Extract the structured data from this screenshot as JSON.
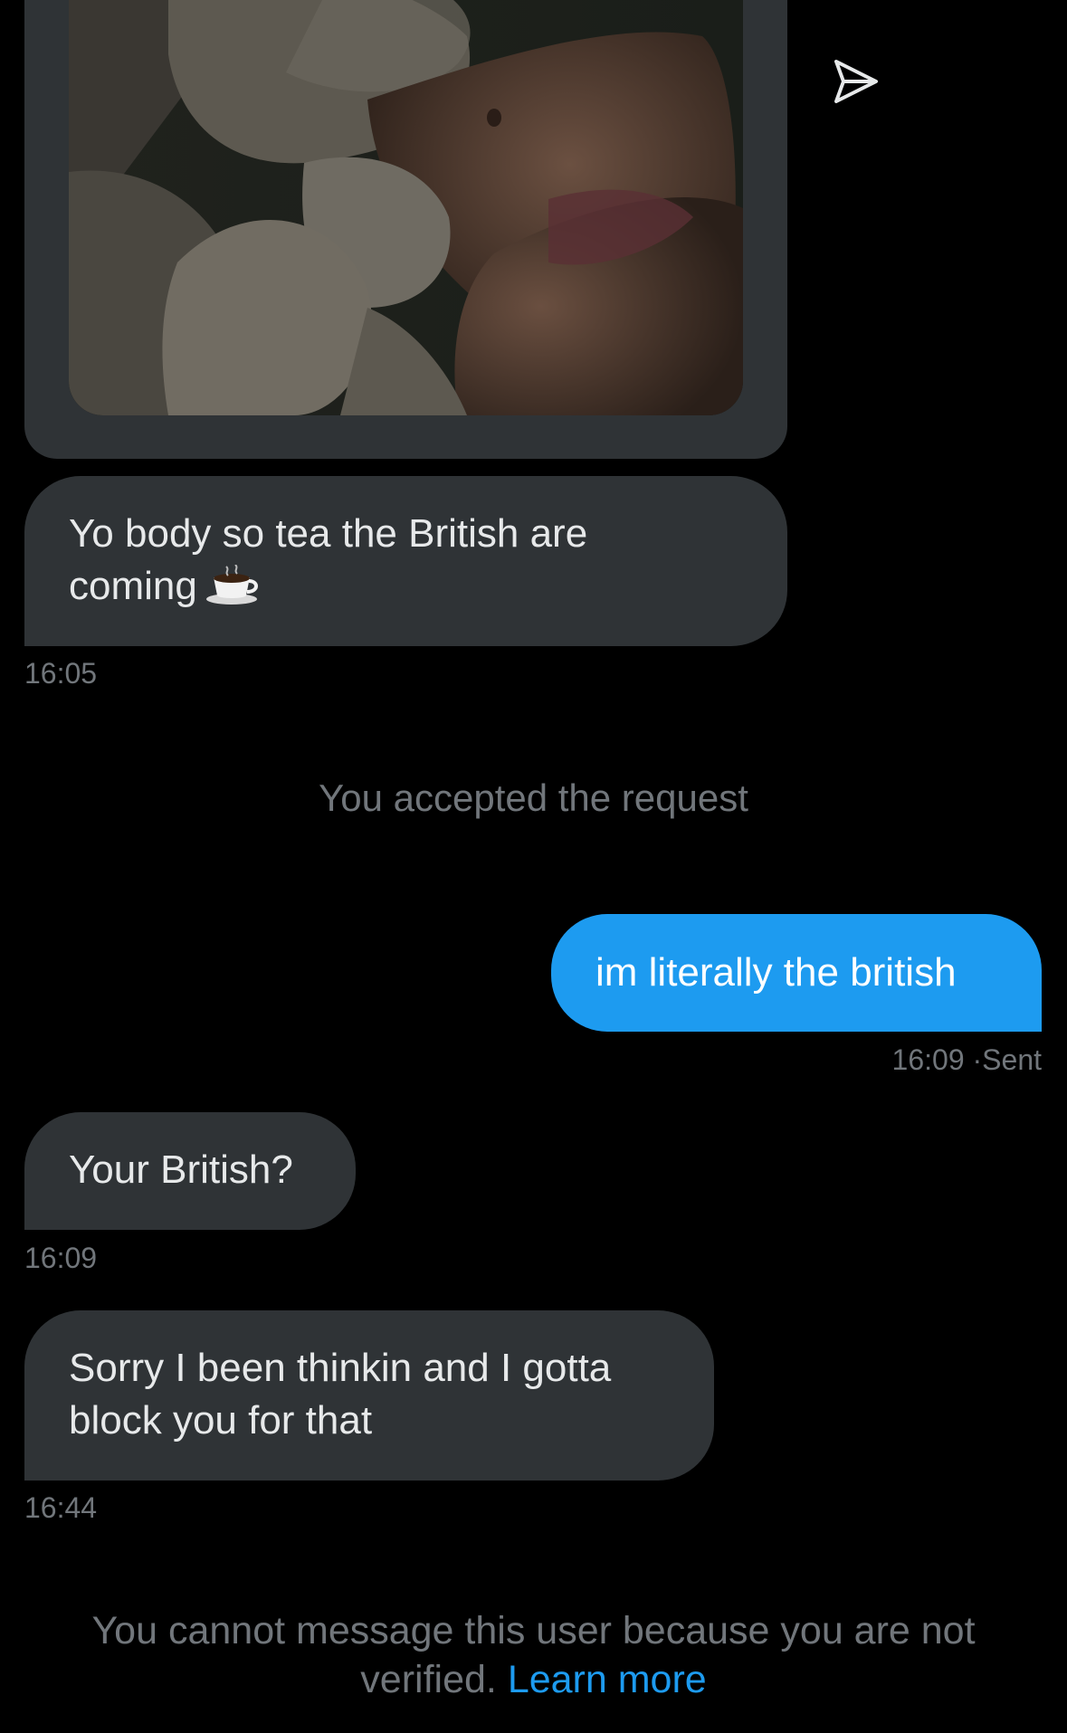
{
  "colors": {
    "background": "#000000",
    "incoming_bubble": "#2f3336",
    "outgoing_bubble": "#1d9bf0",
    "muted_text": "#71767b",
    "link": "#1d9bf0"
  },
  "media_message": {
    "image_description_icon": "photo-attachment",
    "share_icon": "send-icon"
  },
  "messages": [
    {
      "direction": "in",
      "line1": "Yo body so tea the British are",
      "line2": "coming",
      "emoji_icon": "hot-beverage-icon",
      "time": "16:05"
    },
    {
      "direction": "system",
      "text": "You accepted the request"
    },
    {
      "direction": "out",
      "text": "im literally the british",
      "time": "16:09",
      "status": "Sent",
      "separator": "·"
    },
    {
      "direction": "in",
      "text": "Your British?",
      "time": "16:09"
    },
    {
      "direction": "in",
      "line1": "Sorry I been thinkin and I gotta",
      "line2": "block you for that",
      "time": "16:44"
    }
  ],
  "footer": {
    "line1": "You cannot message this user because you are not",
    "line2_prefix": "verified.",
    "link_text": "Learn more"
  }
}
